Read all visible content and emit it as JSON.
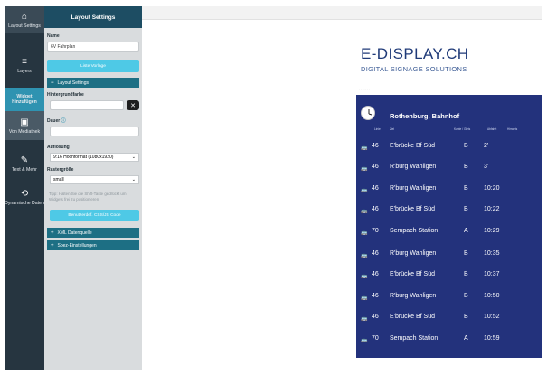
{
  "rail": [
    {
      "icon": "⌂",
      "label": "Layout Settings",
      "state": "hl"
    },
    {
      "icon": "≡",
      "label": "Layers",
      "state": ""
    },
    {
      "icon": "",
      "label": "Widget hinzufügen",
      "state": "active"
    },
    {
      "icon": "▣",
      "label": "Von Mediathek",
      "state": "gray"
    },
    {
      "icon": "✎",
      "label": "Text & Mehr",
      "state": ""
    },
    {
      "icon": "⟲",
      "label": "Dynamische Daten",
      "state": ""
    }
  ],
  "panel": {
    "title": "Layout Settings",
    "name_label": "Name",
    "name_value": "6V Fahrplan",
    "list_button": "Liste Vorlage",
    "section_layout": "Layout Settings",
    "bg_label": "Hintergrundfarbe",
    "duration_label": "Dauer",
    "resolution_label": "Auflösung",
    "resolution_value": "9:16 Hochformat (1080x1920)",
    "grid_label": "Rastergröße",
    "grid_value": "small",
    "hint": "Tipp: Halten Sie die Shift-Taste gedrückt um Widgets frei zu positionieren",
    "css_button": "Benutzerdef. CSS/JS Code",
    "section_xml": "XML Datenquelle",
    "section_extra": "Spez-Einstellungen"
  },
  "display": {
    "brand": "E-DISPLAY.CH",
    "tagline": "DIGITAL SIGNAGE SOLUTIONS",
    "station": "Rothenburg, Bahnhof",
    "col_line": "Linie",
    "col_dest": "Ziel",
    "col_track": "Kante / Gleis",
    "col_dep": "Abfahrt",
    "col_note": "Hinweis",
    "rows": [
      {
        "line": "46",
        "dest": "E'brücke Bf Süd",
        "track": "B",
        "time": "2'"
      },
      {
        "line": "46",
        "dest": "R'burg Wahligen",
        "track": "B",
        "time": "3'"
      },
      {
        "line": "46",
        "dest": "R'burg Wahligen",
        "track": "B",
        "time": "10:20"
      },
      {
        "line": "46",
        "dest": "E'brücke Bf Süd",
        "track": "B",
        "time": "10:22"
      },
      {
        "line": "70",
        "dest": "Sempach Station",
        "track": "A",
        "time": "10:29"
      },
      {
        "line": "46",
        "dest": "R'burg Wahligen",
        "track": "B",
        "time": "10:35"
      },
      {
        "line": "46",
        "dest": "E'brücke Bf Süd",
        "track": "B",
        "time": "10:37"
      },
      {
        "line": "46",
        "dest": "R'burg Wahligen",
        "track": "B",
        "time": "10:50"
      },
      {
        "line": "46",
        "dest": "E'brücke Bf Süd",
        "track": "B",
        "time": "10:52"
      },
      {
        "line": "70",
        "dest": "Sempach Station",
        "track": "A",
        "time": "10:59"
      }
    ]
  },
  "colors": {
    "rail_bg": "#263540",
    "panel_header": "#1d4d63",
    "accent": "#4ec9e6",
    "display_bg": "#23327c"
  }
}
